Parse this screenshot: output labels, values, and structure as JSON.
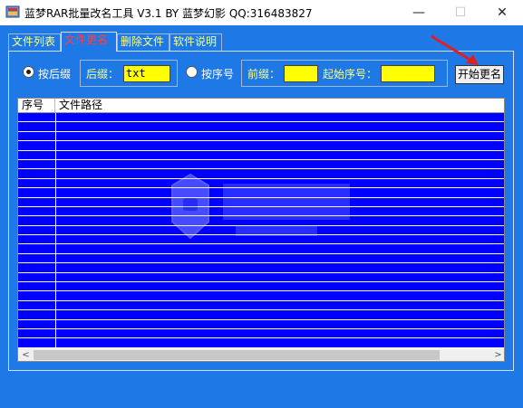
{
  "window": {
    "title": "蓝梦RAR批量改名工具 V3.1 BY 蓝梦幻影 QQ:316483827",
    "minimize_glyph": "—",
    "maximize_glyph": "☐",
    "close_glyph": "✕"
  },
  "tabs": [
    {
      "label": "文件列表"
    },
    {
      "label": "文件更名",
      "active": true
    },
    {
      "label": "删除文件"
    },
    {
      "label": "软件说明"
    }
  ],
  "options": {
    "by_suffix_label": "按后缀",
    "by_suffix_checked": true,
    "suffix_label": "后缀：",
    "suffix_value": "txt",
    "by_sequence_label": "按序号",
    "by_sequence_checked": false,
    "prefix_label": "前缀：",
    "prefix_value": "",
    "start_seq_label": "起始序号：",
    "start_seq_value": ""
  },
  "actions": {
    "start_rename_label": "开始更名"
  },
  "table": {
    "columns": [
      "序号",
      "文件路径"
    ],
    "rows": []
  },
  "scrollbar": {
    "left_glyph": "<",
    "right_glyph": ">"
  },
  "colors": {
    "background": "#1E78E6",
    "list_background": "#0000FF",
    "input_background": "#FFFF00",
    "active_tab_text": "#FF4040",
    "label_text": "#FFFF80"
  },
  "icons": {
    "app": "app-icon",
    "arrow": "red-arrow-icon"
  }
}
